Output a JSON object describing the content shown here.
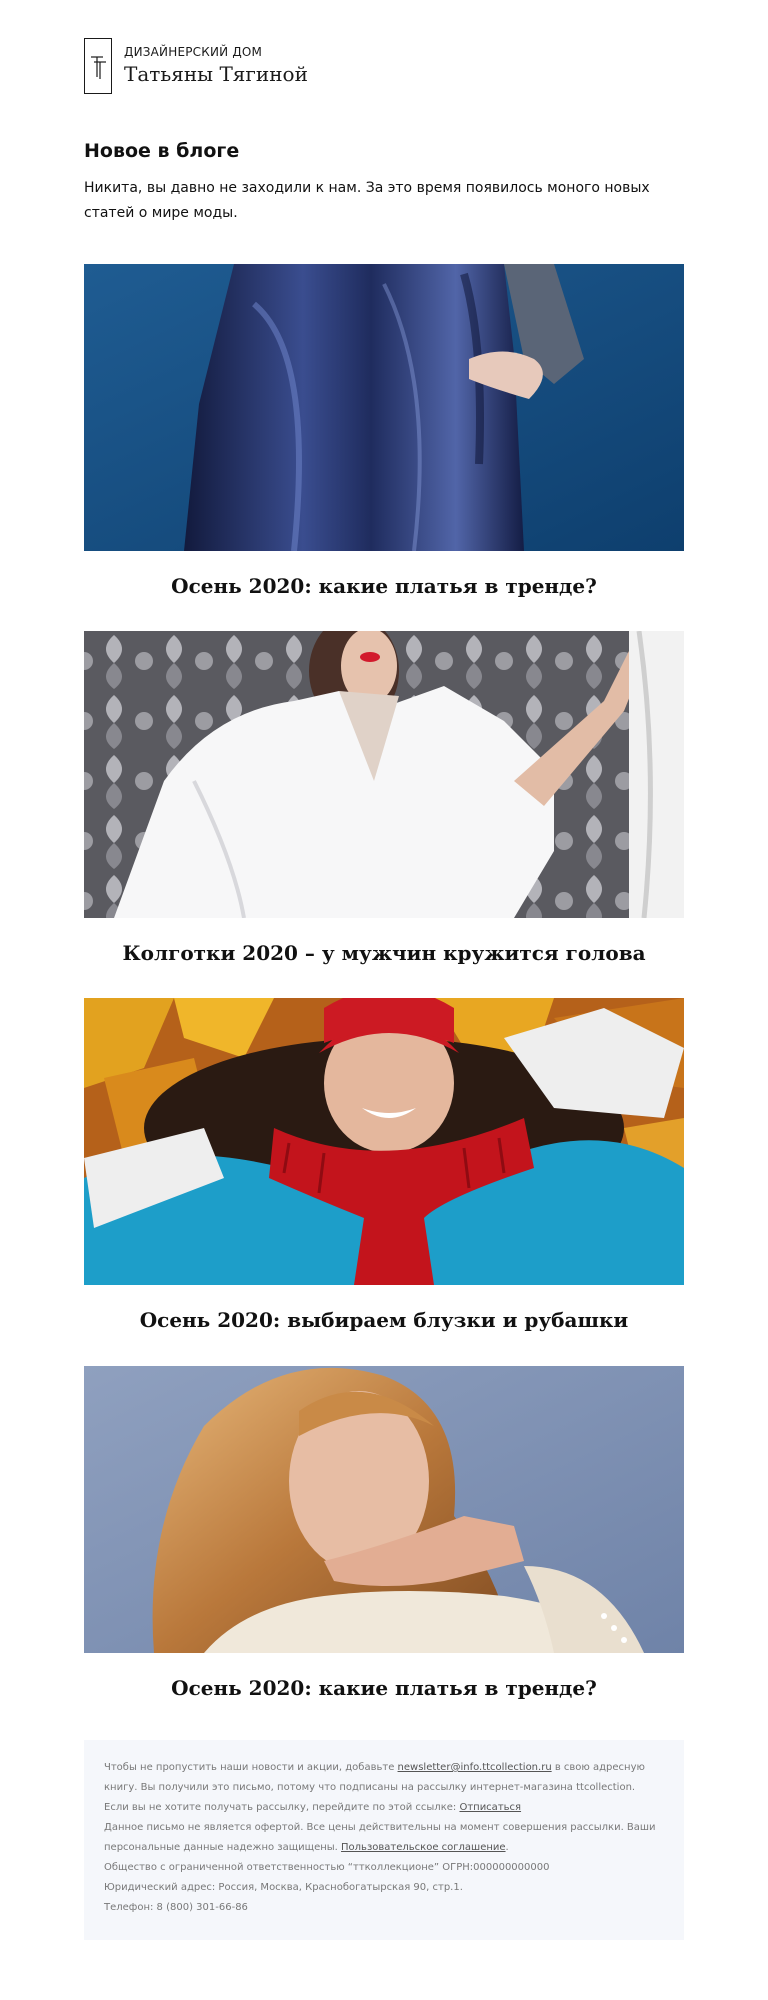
{
  "brand": {
    "line1": "ДИЗАЙНЕРСКИЙ ДОМ",
    "line2": "Татьяны Тягиной",
    "logo_icon": "tt-monogram-icon"
  },
  "intro": {
    "title": "Новое в блоге",
    "text": "Никита, вы давно не заходили к нам. За это время появилось моного новых статей о мире моды."
  },
  "articles": [
    {
      "title": "Осень 2020: какие платья в тренде?",
      "image": "blue-leather-dress-photo"
    },
    {
      "title": "Колготки 2020 – у мужчин кружится голова",
      "image": "white-shirt-woman-photo"
    },
    {
      "title": "Осень 2020: выбираем блузки и рубашки",
      "image": "woman-red-scarf-autumn-leaves-photo"
    },
    {
      "title": "Осень 2020: какие платья в тренде?",
      "image": "blonde-woman-satin-blouse-photo"
    }
  ],
  "footer": {
    "addressbook_prefix": "Чтобы не пропустить наши новости и акции, добавьте ",
    "email_link": "newsletter@info.ttcollection.ru",
    "addressbook_suffix": " в свою адресную книгу. Вы получили это письмо, потому что подписаны на рассылку интернет-магазина ttcollection.",
    "unsubscribe_prefix": "Если вы не хотите получать рассылку, перейдите по этой ссылке: ",
    "unsubscribe_link": "Отписаться",
    "offer_text": "Данное письмо не является офертой. Все цены действительны на момент совершения рассылки. Ваши персональные данные надежно защищены. ",
    "agreement_link": "Пользовательское соглашение",
    "agreement_suffix": ".",
    "company": "Общество с ограниченной ответственностью “ттколлекционе” ОГРН:000000000000",
    "address": "Юридический адрес: Россия, Москва, Краснобогатырская 90, стр.1.",
    "phone": "Телефон: 8 (800) 301-66-86"
  },
  "colors": {
    "background": "#ffffff",
    "text": "#111111",
    "footer_bg": "#f5f7fb",
    "footer_text": "#787878"
  }
}
